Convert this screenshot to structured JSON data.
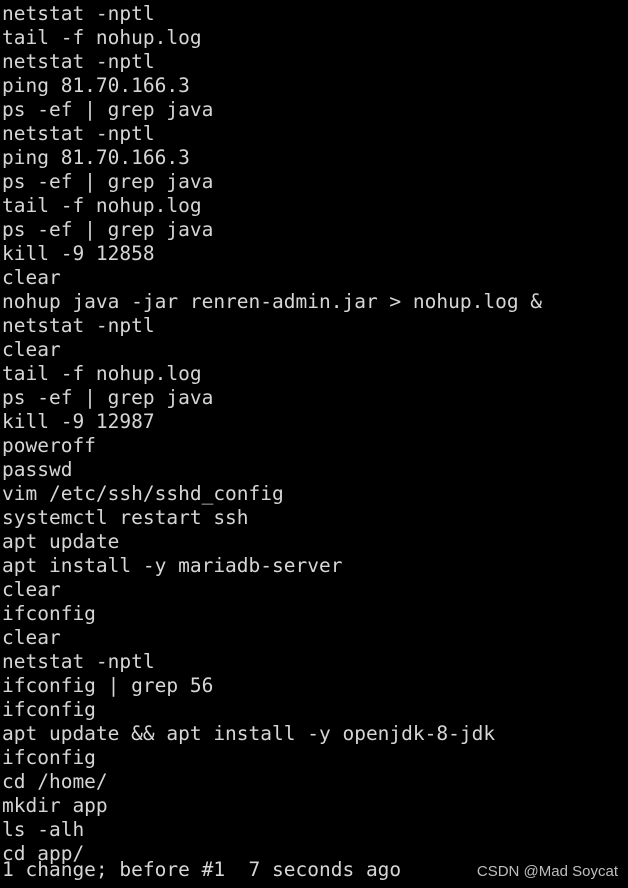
{
  "terminal": {
    "background_color": "#000000",
    "text_color": "#d6d6d6",
    "history_lines": [
      "netstat -nptl",
      "tail -f nohup.log",
      "netstat -nptl",
      "ping 81.70.166.3",
      "ps -ef | grep java",
      "netstat -nptl",
      "ping 81.70.166.3",
      "ps -ef | grep java",
      "tail -f nohup.log",
      "ps -ef | grep java",
      "kill -9 12858",
      "clear",
      "nohup java -jar renren-admin.jar > nohup.log &",
      "netstat -nptl",
      "clear",
      "tail -f nohup.log",
      "ps -ef | grep java",
      "kill -9 12987",
      "poweroff",
      "passwd",
      "vim /etc/ssh/sshd_config",
      "systemctl restart ssh",
      "apt update",
      "apt install -y mariadb-server",
      "clear",
      "ifconfig",
      "clear",
      "netstat -nptl",
      "ifconfig | grep 56",
      "ifconfig",
      "apt update && apt install -y openjdk-8-jdk",
      "ifconfig",
      "cd /home/",
      "mkdir app",
      "ls -alh",
      "cd app/"
    ],
    "status_line": "1 change; before #1  7 seconds ago",
    "watermark": "CSDN @Mad Soycat"
  }
}
